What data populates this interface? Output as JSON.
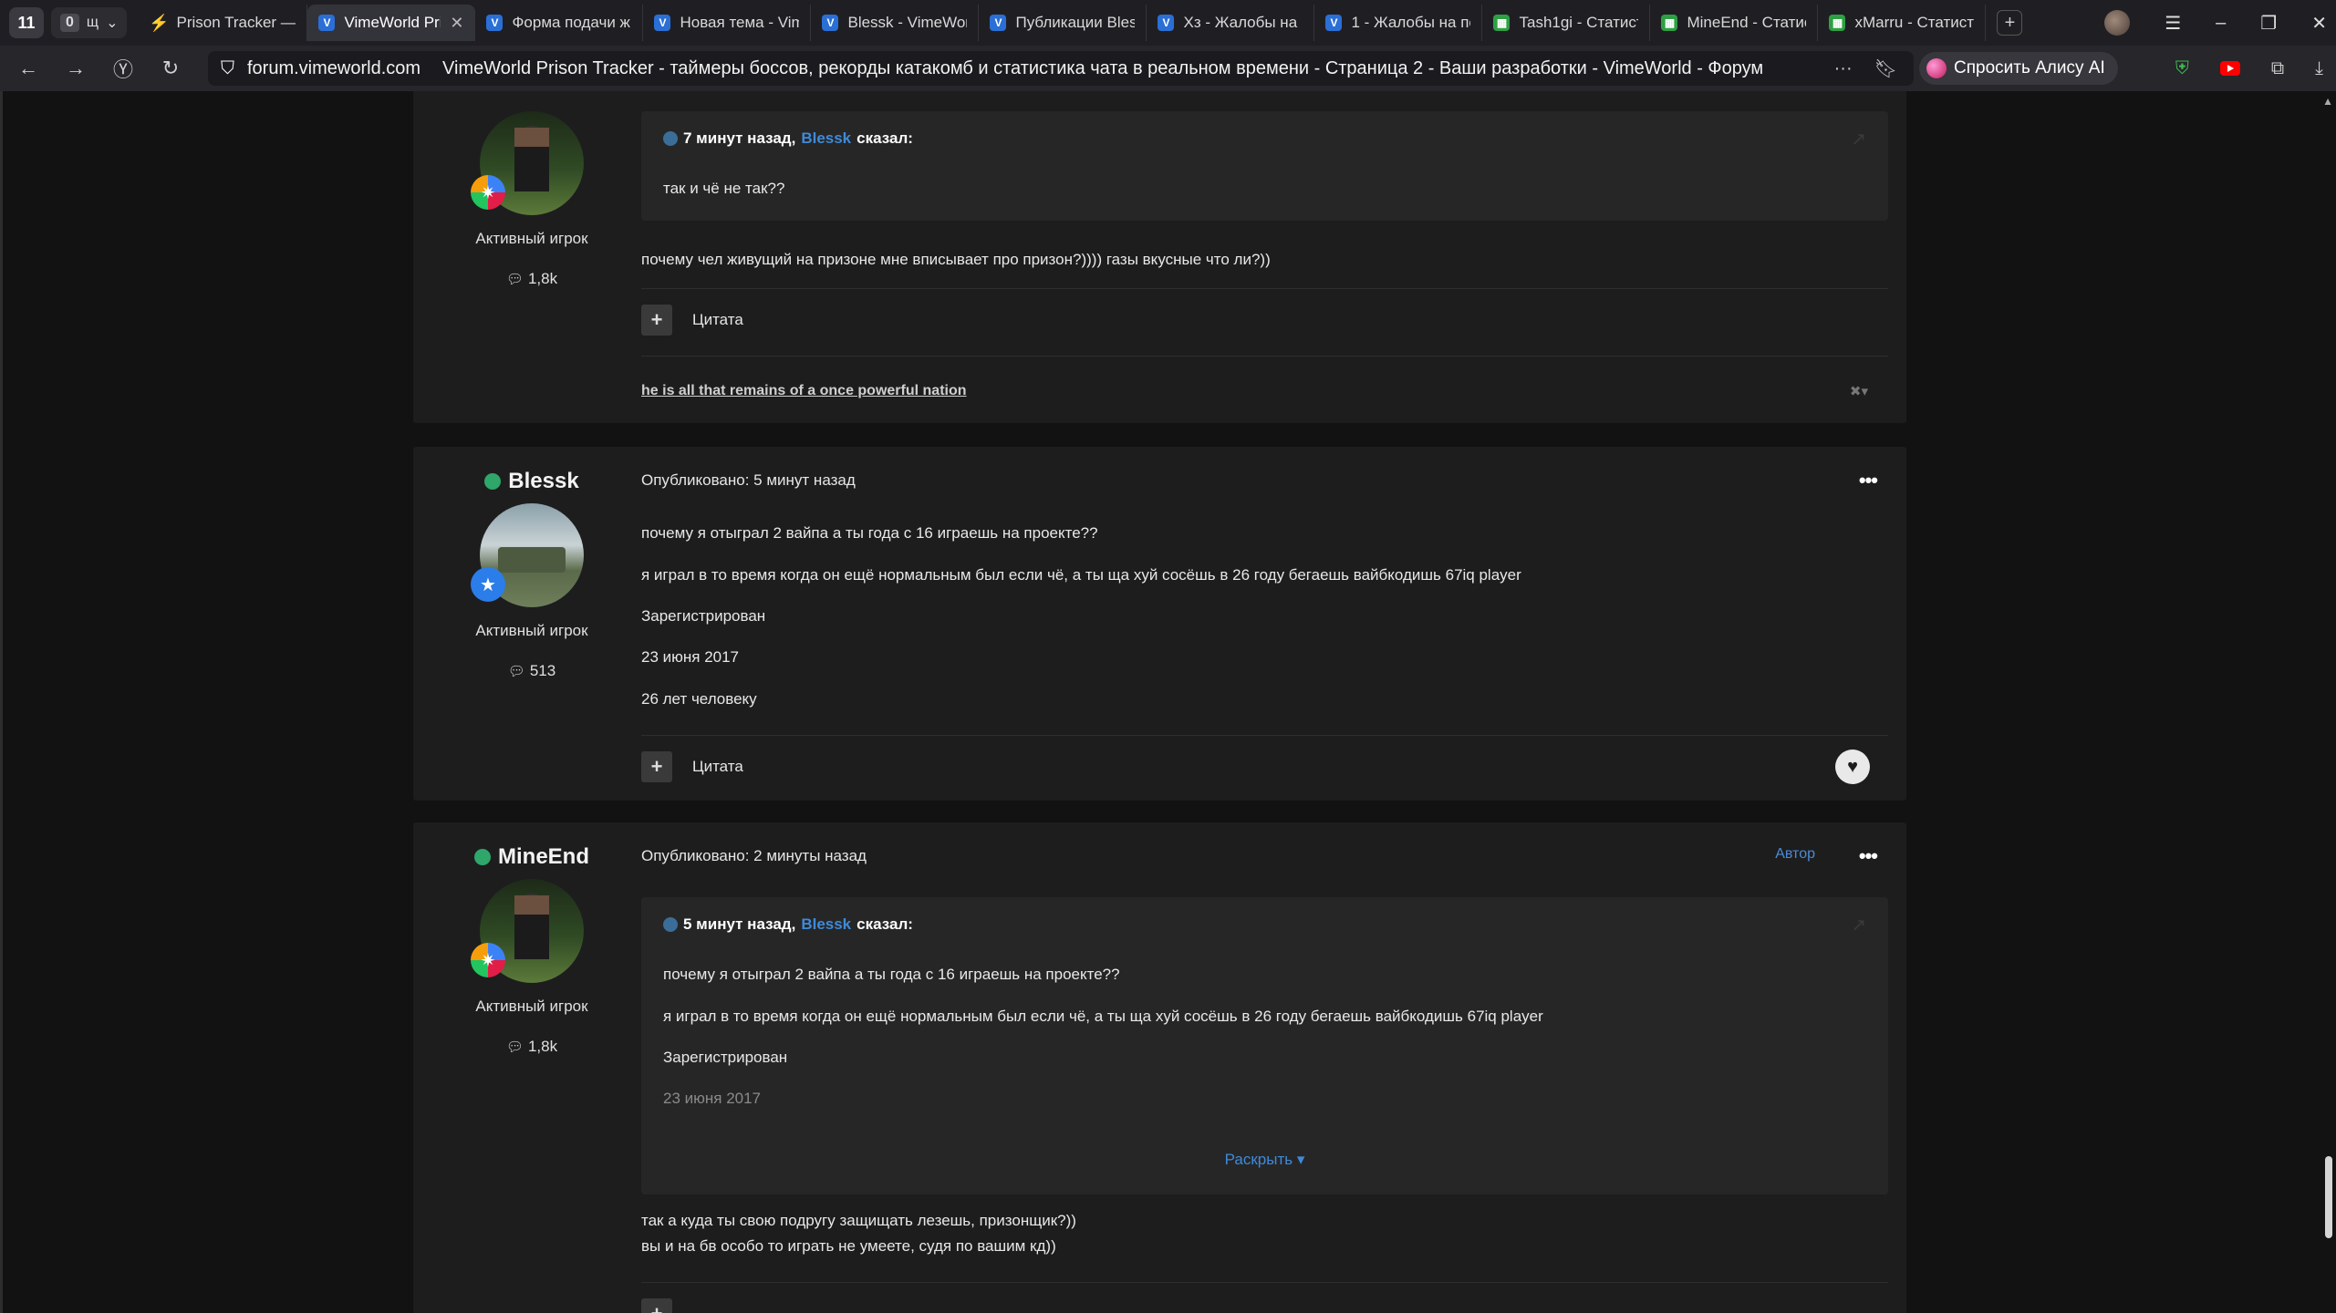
{
  "browser": {
    "tab_count": "11",
    "tab_group": {
      "count": "0",
      "label": "щ"
    },
    "tabs": [
      {
        "label": "Prison Tracker —",
        "icon": "bolt"
      },
      {
        "label": "VimeWorld Pri",
        "icon": "vime",
        "active": true
      },
      {
        "label": "Форма подачи ж",
        "icon": "vime"
      },
      {
        "label": "Новая тема - Vim",
        "icon": "vime"
      },
      {
        "label": "Blessk - VimeWor",
        "icon": "vime"
      },
      {
        "label": "Публикации Bles",
        "icon": "vime"
      },
      {
        "label": "Хз - Жалобы на п",
        "icon": "vime"
      },
      {
        "label": "1 - Жалобы на по",
        "icon": "vime"
      },
      {
        "label": "Tash1gi - Статист",
        "icon": "stat"
      },
      {
        "label": "MineEnd - Статис",
        "icon": "stat"
      },
      {
        "label": "xMarru - Статист",
        "icon": "stat"
      }
    ],
    "new_tab": "+",
    "domain": "forum.vimeworld.com",
    "page_title": "VimeWorld Prison Tracker - таймеры боссов, рекорды катакомб и статистика чата в реальном времени - Страница 2 - Ваши разработки - VimeWorld - Форум",
    "alice_label": "Спросить Алису AI"
  },
  "posts": {
    "first": {
      "rank": "Активный игрок",
      "count": "1,8k",
      "quote_time": "7 минут назад,",
      "quote_user": "Blessk",
      "quote_said": "сказал:",
      "quote_text": "так и чё не так??",
      "body": "почему чел живущий на призоне мне вписывает про призон?)))) газы вкусные что ли?))",
      "cite": "Цитата",
      "signature": "he is all that remains of a once powerful nation"
    },
    "second": {
      "author": "Blessk",
      "rank": "Активный игрок",
      "count": "513",
      "published": "Опубликовано: 5 минут назад",
      "lines": [
        "почему я отыграл 2 вайпа а ты года с 16 играешь на проекте??",
        "я играл в то время когда он ещё нормальным был если чё, а ты ща хуй сосёшь в 26 году бегаешь вайбкодишь 67iq player",
        "Зарегистрирован",
        "23 июня 2017",
        "26 лет человеку"
      ],
      "cite": "Цитата"
    },
    "third": {
      "author": "MineEnd",
      "rank": "Активный игрок",
      "count": "1,8k",
      "published": "Опубликовано: 2 минуты назад",
      "author_tag": "Автор",
      "quote_time": "5 минут назад,",
      "quote_user": "Blessk",
      "quote_said": "сказал:",
      "quote_lines": [
        "почему я отыграл 2 вайпа а ты года с 16 играешь на проекте??",
        "я играл в то время когда он ещё нормальным был если чё, а ты ща хуй сосёшь в 26 году бегаешь вайбкодишь 67iq player",
        "Зарегистрирован",
        "23 июня 2017"
      ],
      "expand": "Раскрыть",
      "body_lines": [
        "так а куда ты свою подругу защищать лезешь, призонщик?))",
        "вы и на бв особо то играть не умеете, судя по вашим кд))"
      ]
    }
  }
}
